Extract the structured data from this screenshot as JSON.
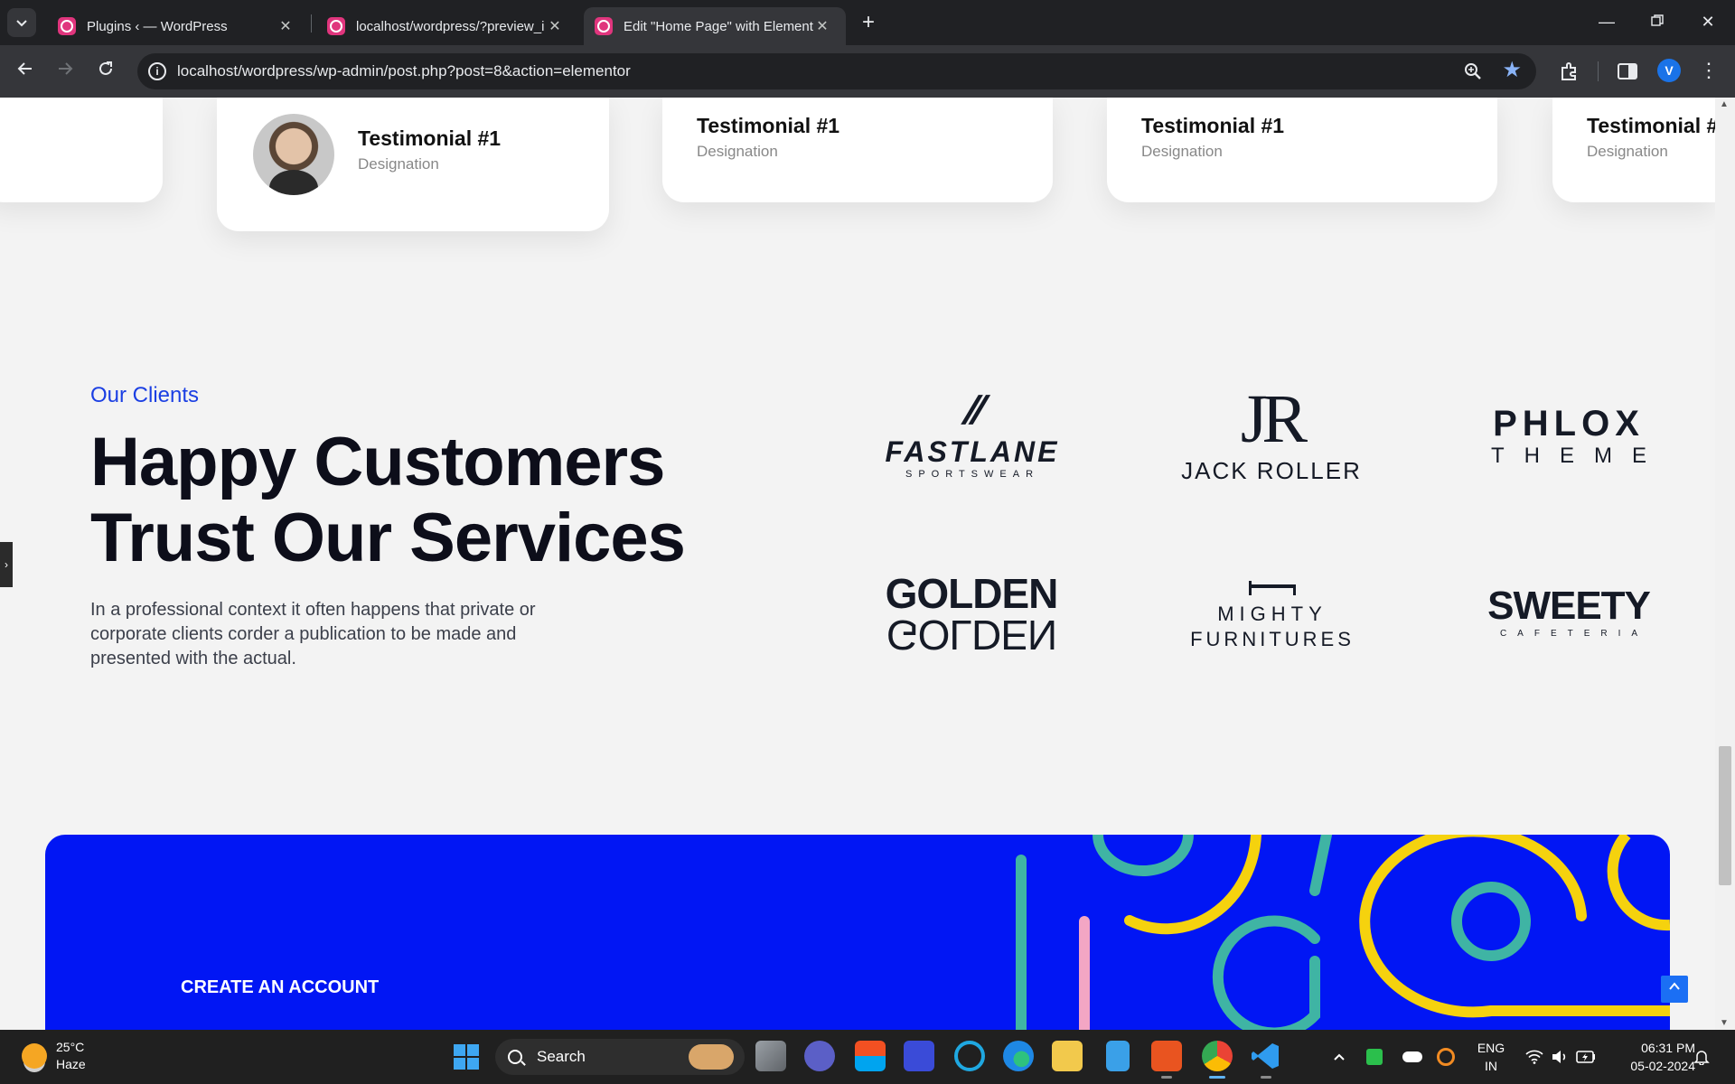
{
  "browser": {
    "tabs": [
      {
        "title": "Plugins ‹ — WordPress",
        "active": false
      },
      {
        "title": "localhost/wordpress/?preview_i",
        "active": false
      },
      {
        "title": "Edit \"Home Page\" with Element",
        "active": true
      }
    ],
    "url": "localhost/wordpress/wp-admin/post.php?post=8&action=elementor",
    "profile_initial": "V"
  },
  "testimonials": [
    {
      "name": "Testimonial #1",
      "designation": "Designation"
    },
    {
      "name": "Testimonial #1",
      "designation": "Designation"
    },
    {
      "name": "Testimonial #1",
      "designation": "Designation"
    },
    {
      "name": "Testimonial #",
      "designation": "Designation"
    }
  ],
  "clients": {
    "eyebrow": "Our Clients",
    "headline_line1": "Happy Customers",
    "headline_line2": "Trust Our Services",
    "paragraph": "In a professional context it often happens that private or corporate clients corder a publication to be made and presented with the actual.",
    "logos": [
      {
        "main": "FASTLANE",
        "sub": "SPORTSWEAR",
        "mark": "//"
      },
      {
        "main": "JACK ROLLER",
        "sub": "",
        "mark": "JR"
      },
      {
        "main": "PHLOX",
        "sub": "THEME",
        "mark": ""
      },
      {
        "main": "GOLDEN",
        "sub": "GOLDEN",
        "mark": ""
      },
      {
        "main": "MIGHTY",
        "sub": "FURNITURES",
        "mark": ""
      },
      {
        "main": "SWEETY",
        "sub": "CAFETERIA",
        "mark": ""
      }
    ]
  },
  "cta": {
    "label": "CREATE AN ACCOUNT",
    "color": "#0116f4",
    "accent_yellow": "#f5d20e",
    "accent_teal": "#3fb4a4",
    "accent_pink": "#f3a6c4"
  },
  "taskbar": {
    "temperature": "25°C",
    "condition": "Haze",
    "search_placeholder": "Search",
    "lang_line1": "ENG",
    "lang_line2": "IN",
    "time": "06:31 PM",
    "date": "05-02-2024"
  }
}
